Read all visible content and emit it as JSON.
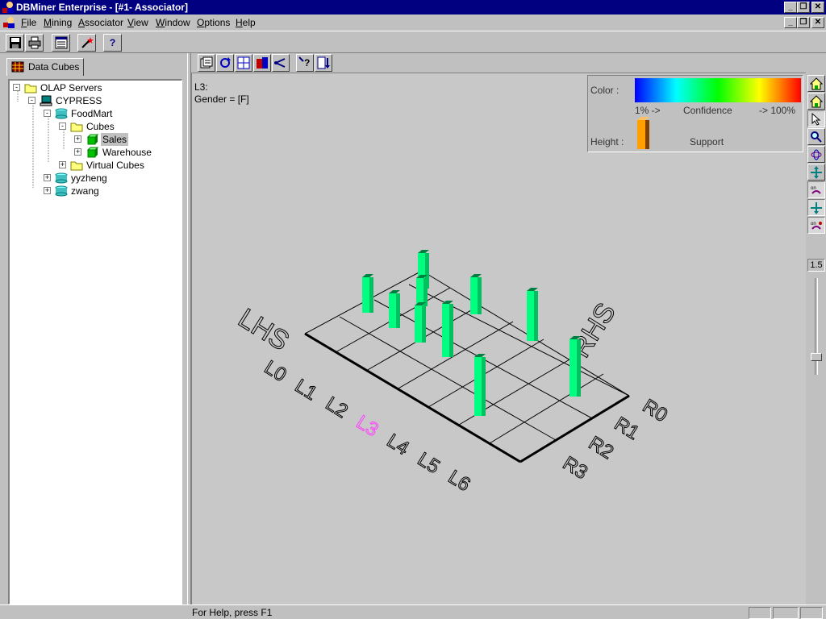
{
  "window": {
    "title": "DBMiner Enterprise - [#1- Associator]"
  },
  "menu": {
    "items": [
      {
        "label": "File",
        "hotkey": "F"
      },
      {
        "label": "Mining",
        "hotkey": "M"
      },
      {
        "label": "Associator",
        "hotkey": "A"
      },
      {
        "label": "View",
        "hotkey": "V"
      },
      {
        "label": "Window",
        "hotkey": "W"
      },
      {
        "label": "Options",
        "hotkey": "O"
      },
      {
        "label": "Help",
        "hotkey": "H"
      }
    ]
  },
  "left_panel": {
    "tab_label": "Data Cubes",
    "tree": [
      {
        "label": "OLAP Servers",
        "expander": "-",
        "icon": "folder-icon"
      },
      {
        "label": "CYPRESS",
        "expander": "-",
        "icon": "computer-icon"
      },
      {
        "label": "FoodMart",
        "expander": "-",
        "icon": "database-icon"
      },
      {
        "label": "Cubes",
        "expander": "-",
        "icon": "folder-icon"
      },
      {
        "label": "Sales",
        "expander": "+",
        "icon": "cube-icon",
        "selected": true
      },
      {
        "label": "Warehouse",
        "expander": "+",
        "icon": "cube-icon"
      },
      {
        "label": "Virtual Cubes",
        "expander": "+",
        "icon": "folder-icon"
      },
      {
        "label": "yyzheng",
        "expander": "+",
        "icon": "database-icon"
      },
      {
        "label": "zwang",
        "expander": "+",
        "icon": "database-icon"
      }
    ]
  },
  "associator": {
    "rule_line1": "L3:",
    "rule_line2": "Gender = [F]",
    "legend": {
      "color_label": "Color :",
      "low_label": "1% ->",
      "mid_label": "Confidence",
      "high_label": "-> 100%",
      "height_label": "Height :",
      "height_meaning": "Support",
      "gradient_colors": [
        "#0000ff",
        "#00ffff",
        "#00ff00",
        "#ffff00",
        "#ff0000"
      ]
    },
    "grid": {
      "lhs_axis_label": "LHS",
      "rhs_axis_label": "RHS",
      "lhs_labels": [
        "L6",
        "L5",
        "L4",
        "L3",
        "L2",
        "L1",
        "L0"
      ],
      "rhs_labels": [
        "R0",
        "R1",
        "R2",
        "R3"
      ],
      "highlight_lhs": "L3",
      "highlight_color": "#ff40ff"
    },
    "zoom_value": "1.5"
  },
  "status": {
    "text": "For Help, press F1"
  }
}
